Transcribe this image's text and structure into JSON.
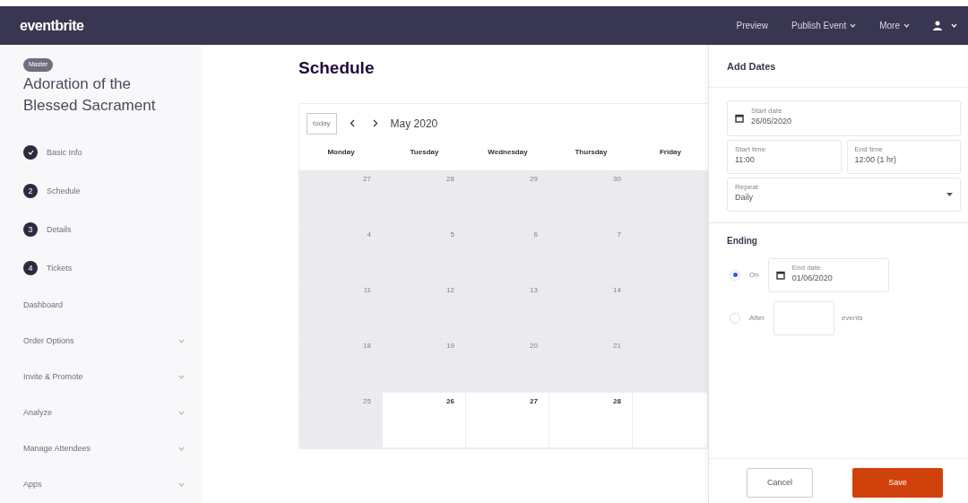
{
  "navbar": {
    "logo": "eventbrite",
    "links": [
      {
        "label": "Preview",
        "dropdown": false
      },
      {
        "label": "Publish Event",
        "dropdown": true
      },
      {
        "label": "More",
        "dropdown": true
      }
    ],
    "account": {
      "dropdown": true
    }
  },
  "sidebar": {
    "badge": "Master",
    "event_title": "Adoration of the Blessed Sacrament",
    "steps": [
      {
        "label": "Basic Info",
        "done": true
      },
      {
        "label": "Schedule",
        "done": false,
        "number": "2"
      },
      {
        "label": "Details",
        "done": false,
        "number": "3"
      },
      {
        "label": "Tickets",
        "done": false,
        "number": "4"
      }
    ],
    "items": [
      {
        "label": "Dashboard",
        "expandable": false
      },
      {
        "label": "Order Options",
        "expandable": true
      },
      {
        "label": "Invite & Promote",
        "expandable": true
      },
      {
        "label": "Analyze",
        "expandable": true
      },
      {
        "label": "Manage Attendees",
        "expandable": true
      },
      {
        "label": "Apps",
        "expandable": true
      }
    ]
  },
  "schedule": {
    "title": "Schedule",
    "today_button": "today",
    "month": "May 2020",
    "weekdays": [
      "Monday",
      "Tuesday",
      "Wednesday",
      "Thursday",
      "Friday"
    ],
    "weeks": [
      [
        {
          "day": "27",
          "past": true
        },
        {
          "day": "28",
          "past": true
        },
        {
          "day": "29",
          "past": true
        },
        {
          "day": "30",
          "past": true
        },
        {
          "past": true
        }
      ],
      [
        {
          "day": "4",
          "past": true
        },
        {
          "day": "5",
          "past": true
        },
        {
          "day": "6",
          "past": true
        },
        {
          "day": "7",
          "past": true
        },
        {
          "past": true
        }
      ],
      [
        {
          "day": "11",
          "past": true
        },
        {
          "day": "12",
          "past": true
        },
        {
          "day": "13",
          "past": true
        },
        {
          "day": "14",
          "past": true
        },
        {
          "past": true
        }
      ],
      [
        {
          "day": "18",
          "past": true
        },
        {
          "day": "19",
          "past": true
        },
        {
          "day": "20",
          "past": true
        },
        {
          "day": "21",
          "past": true
        },
        {
          "past": true
        }
      ],
      [
        {
          "day": "25",
          "past": true
        },
        {
          "day": "26",
          "past": false
        },
        {
          "day": "27",
          "past": false
        },
        {
          "day": "28",
          "past": false
        },
        {
          "past": false
        }
      ]
    ]
  },
  "panel": {
    "title": "Add Dates",
    "start_date": {
      "label": "Start date",
      "value": "26/05/2020"
    },
    "start_time": {
      "label": "Start time",
      "value": "11:00"
    },
    "end_time": {
      "label": "End time",
      "value": "12:00 (1 hr)"
    },
    "repeat": {
      "label": "Repeat",
      "value": "Daily"
    },
    "ending_title": "Ending",
    "ending_options": [
      {
        "kind": "date",
        "label": "On",
        "selected": true,
        "field_label": "End date",
        "value": "01/06/2020"
      },
      {
        "kind": "count",
        "label": "After",
        "selected": false,
        "suffix": "events"
      }
    ],
    "buttons": [
      {
        "kind": "secondary",
        "label": "Cancel"
      },
      {
        "kind": "primary",
        "label": "Save"
      }
    ]
  }
}
